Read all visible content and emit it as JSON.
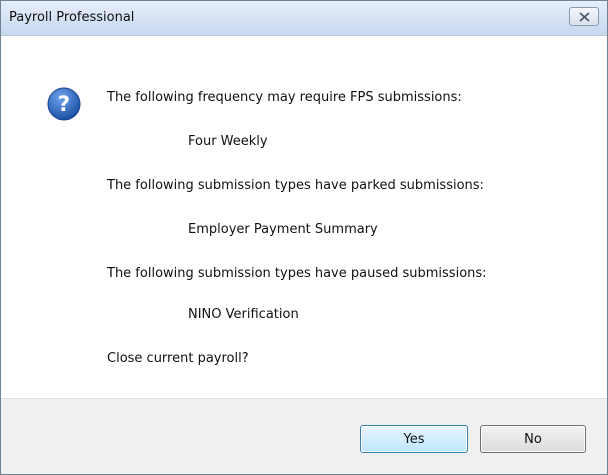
{
  "window": {
    "title": "Payroll Professional",
    "close_icon": "close-icon"
  },
  "message": {
    "icon": "question-icon",
    "lines": [
      "The following frequency may require FPS submissions:",
      "Four Weekly",
      "The following submission types have parked submissions:",
      "Employer Payment Summary",
      "The following submission types have paused submissions:",
      "NINO Verification",
      "Close current payroll?"
    ]
  },
  "buttons": {
    "yes_label": "Yes",
    "no_label": "No"
  },
  "colors": {
    "titlebar": "#c8d8ef",
    "footer": "#f0f0f0",
    "question_icon": "#2b63b8"
  }
}
